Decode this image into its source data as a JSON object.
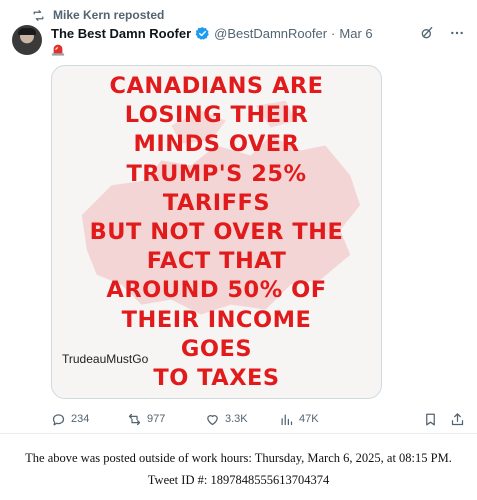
{
  "repost": {
    "text": "Mike Kern reposted"
  },
  "tweet": {
    "author_name": "The Best Damn Roofer",
    "handle": "@BestDamnRoofer",
    "separator": "·",
    "date": "Mar 6",
    "flag_icon": "siren-emoji",
    "media": {
      "lines": [
        "CANADIANS ARE",
        "LOSING THEIR",
        "MINDS OVER",
        "TRUMP'S 25%",
        "TARIFFS",
        "BUT NOT OVER THE",
        "FACT THAT",
        "AROUND 50% OF",
        "THEIR INCOME",
        "GOES",
        "TO TAXES"
      ],
      "watermark": "TrudeauMustGo",
      "text_color": "#e11b1b"
    },
    "actions": {
      "replies": "234",
      "reposts": "977",
      "likes": "3.3K",
      "views": "47K"
    }
  },
  "footer": {
    "line1": "The above was posted outside of work hours: Thursday, March 6, 2025, at 08:15 PM.",
    "line2": "Tweet ID #: 1897848555613704374"
  },
  "colors": {
    "accent": "#1d9bf0",
    "muted": "#536471"
  }
}
